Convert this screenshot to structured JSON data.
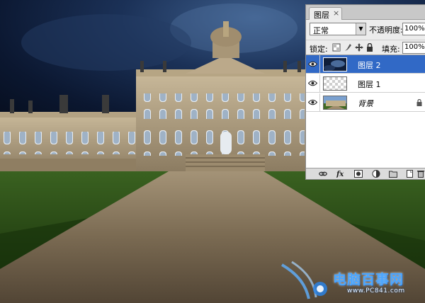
{
  "panel": {
    "tab_label": "图层",
    "tab_close": "×",
    "blend_mode": "正常",
    "opacity_label": "不透明度:",
    "opacity_value": "100%",
    "lock_label": "锁定:",
    "fill_label": "填充:",
    "fill_value": "100%",
    "layers": [
      {
        "name": "图层 2",
        "selected": true,
        "visible": true,
        "thumb": "dark-sky"
      },
      {
        "name": "图层 1",
        "selected": false,
        "visible": true,
        "thumb": "transparent"
      },
      {
        "name": "背景",
        "selected": false,
        "visible": true,
        "thumb": "palace",
        "locked": true
      }
    ],
    "footer_icons": [
      "link-icon",
      "fx-icon",
      "mask-icon",
      "adjustment-icon",
      "folder-icon",
      "new-layer-icon",
      "trash-icon"
    ]
  },
  "watermark": {
    "title": "电脑百事网",
    "url": "www.PC841.com"
  },
  "colors": {
    "selection": "#3169c6",
    "panel_bg": "#ececec",
    "sky": "#0c1a33",
    "grass": "#2f5516",
    "path": "#8a7a60"
  }
}
